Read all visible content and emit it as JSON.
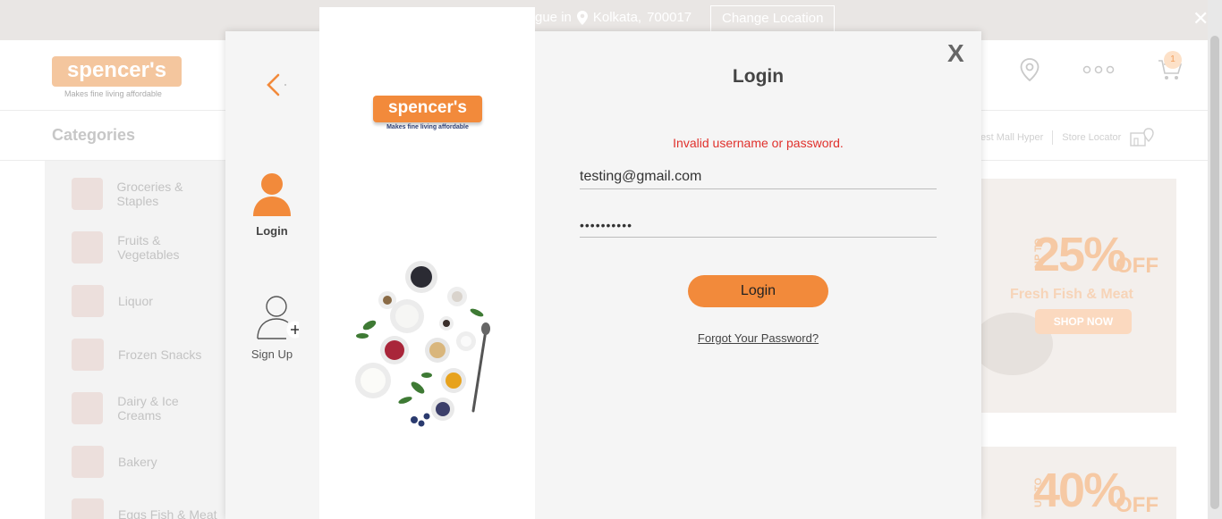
{
  "topbar": {
    "deliver_text": "gue in",
    "city": "Kolkata,",
    "pincode": "700017",
    "change_location": "Change Location",
    "close": "✕"
  },
  "header": {
    "logo_text": "spencer's",
    "logo_tagline": "Makes fine living affordable",
    "cart_count": "1"
  },
  "catbar": {
    "title": "Categories",
    "store_name": "est Mall Hyper",
    "store_locator": "Store Locator"
  },
  "categories": [
    {
      "label": "Groceries & Staples"
    },
    {
      "label": "Fruits & Vegetables"
    },
    {
      "label": "Liquor"
    },
    {
      "label": "Frozen Snacks"
    },
    {
      "label": "Dairy & Ice Creams"
    },
    {
      "label": "Bakery"
    },
    {
      "label": "Eggs Fish & Meat"
    }
  ],
  "banners": [
    {
      "upto": "UP TO",
      "pct": "25%",
      "off": "OFF",
      "sub": "Fresh Fish & Meat",
      "cta": "SHOP NOW"
    },
    {
      "upto": "UP TO",
      "pct": "40%",
      "off": "OFF"
    }
  ],
  "modal": {
    "tab_login": "Login",
    "tab_signup": "Sign Up",
    "logo_text": "spencer's",
    "logo_tagline": "Makes fine living affordable",
    "title": "Login",
    "close": "X",
    "error": "Invalid username or password.",
    "email_value": "testing@gmail.com",
    "password_value": "••••••••••",
    "login_button": "Login",
    "forgot": "Forgot Your Password?"
  },
  "colors": {
    "accent": "#f28a3b",
    "error": "#e0312c"
  }
}
